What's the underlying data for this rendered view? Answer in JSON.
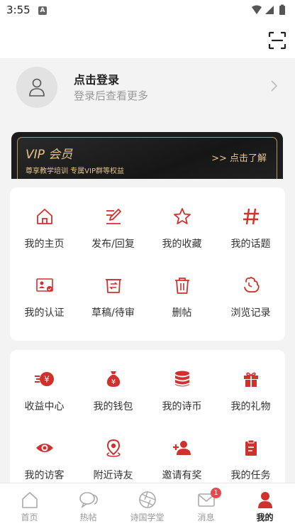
{
  "status_bar": {
    "time": "3:55",
    "notification_letter": "A"
  },
  "profile": {
    "title": "点击登录",
    "subtitle": "登录后查看更多"
  },
  "vip": {
    "title": "VIP 会员",
    "desc": "尊享教学培训 专属VIP群等权益",
    "link": ">> 点击了解"
  },
  "colors": {
    "accent": "#d0312d",
    "vip_gold": "#e6c58b",
    "badge": "#e8474d"
  },
  "menu1": [
    {
      "label": "我的主页",
      "icon": "home-icon"
    },
    {
      "label": "发布/回复",
      "icon": "edit-icon"
    },
    {
      "label": "我的收藏",
      "icon": "star-icon"
    },
    {
      "label": "我的话题",
      "icon": "hash-icon"
    },
    {
      "label": "我的认证",
      "icon": "id-card-icon"
    },
    {
      "label": "草稿/待审",
      "icon": "draft-icon"
    },
    {
      "label": "删帖",
      "icon": "trash-icon"
    },
    {
      "label": "浏览记录",
      "icon": "history-icon"
    }
  ],
  "menu2": [
    {
      "label": "收益中心",
      "icon": "income-icon"
    },
    {
      "label": "我的钱包",
      "icon": "moneybag-icon"
    },
    {
      "label": "我的诗币",
      "icon": "coins-icon"
    },
    {
      "label": "我的礼物",
      "icon": "gift-icon"
    },
    {
      "label": "我的访客",
      "icon": "eye-icon"
    },
    {
      "label": "附近诗友",
      "icon": "location-icon"
    },
    {
      "label": "邀请有奖",
      "icon": "invite-icon"
    },
    {
      "label": "我的任务",
      "icon": "clipboard-icon"
    }
  ],
  "tabs": [
    {
      "label": "首页"
    },
    {
      "label": "热帖"
    },
    {
      "label": "诗国学堂"
    },
    {
      "label": "消息",
      "badge": "1"
    },
    {
      "label": "我的"
    }
  ]
}
